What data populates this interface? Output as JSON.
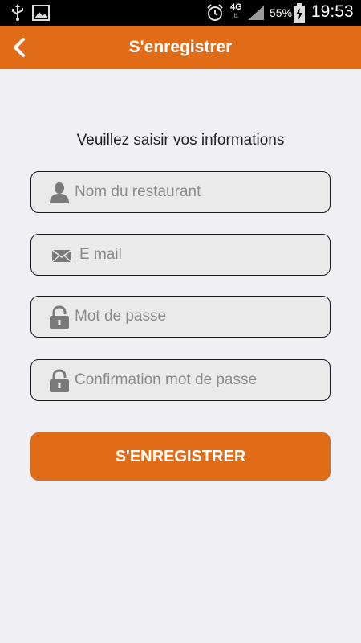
{
  "status_bar": {
    "network": "4G",
    "network_arrows": "⇅",
    "battery": "55%",
    "time": "19:53"
  },
  "app_bar": {
    "title": "S'enregistrer",
    "back_icon": "chevron-left-icon"
  },
  "form": {
    "instructions": "Veuillez saisir vos informations",
    "fields": [
      {
        "icon": "user-icon",
        "placeholder": "Nom du restaurant",
        "value": ""
      },
      {
        "icon": "mail-icon",
        "placeholder": "E mail",
        "value": ""
      },
      {
        "icon": "lock-icon",
        "placeholder": "Mot de passe",
        "value": ""
      },
      {
        "icon": "lock-icon",
        "placeholder": "Confirmation mot de passe",
        "value": ""
      }
    ],
    "submit_label": "S'ENREGISTRER"
  },
  "colors": {
    "accent": "#e06c17",
    "background": "#efeff4",
    "field_background": "#eaeaea",
    "icon_gray": "#7a7a7a"
  }
}
